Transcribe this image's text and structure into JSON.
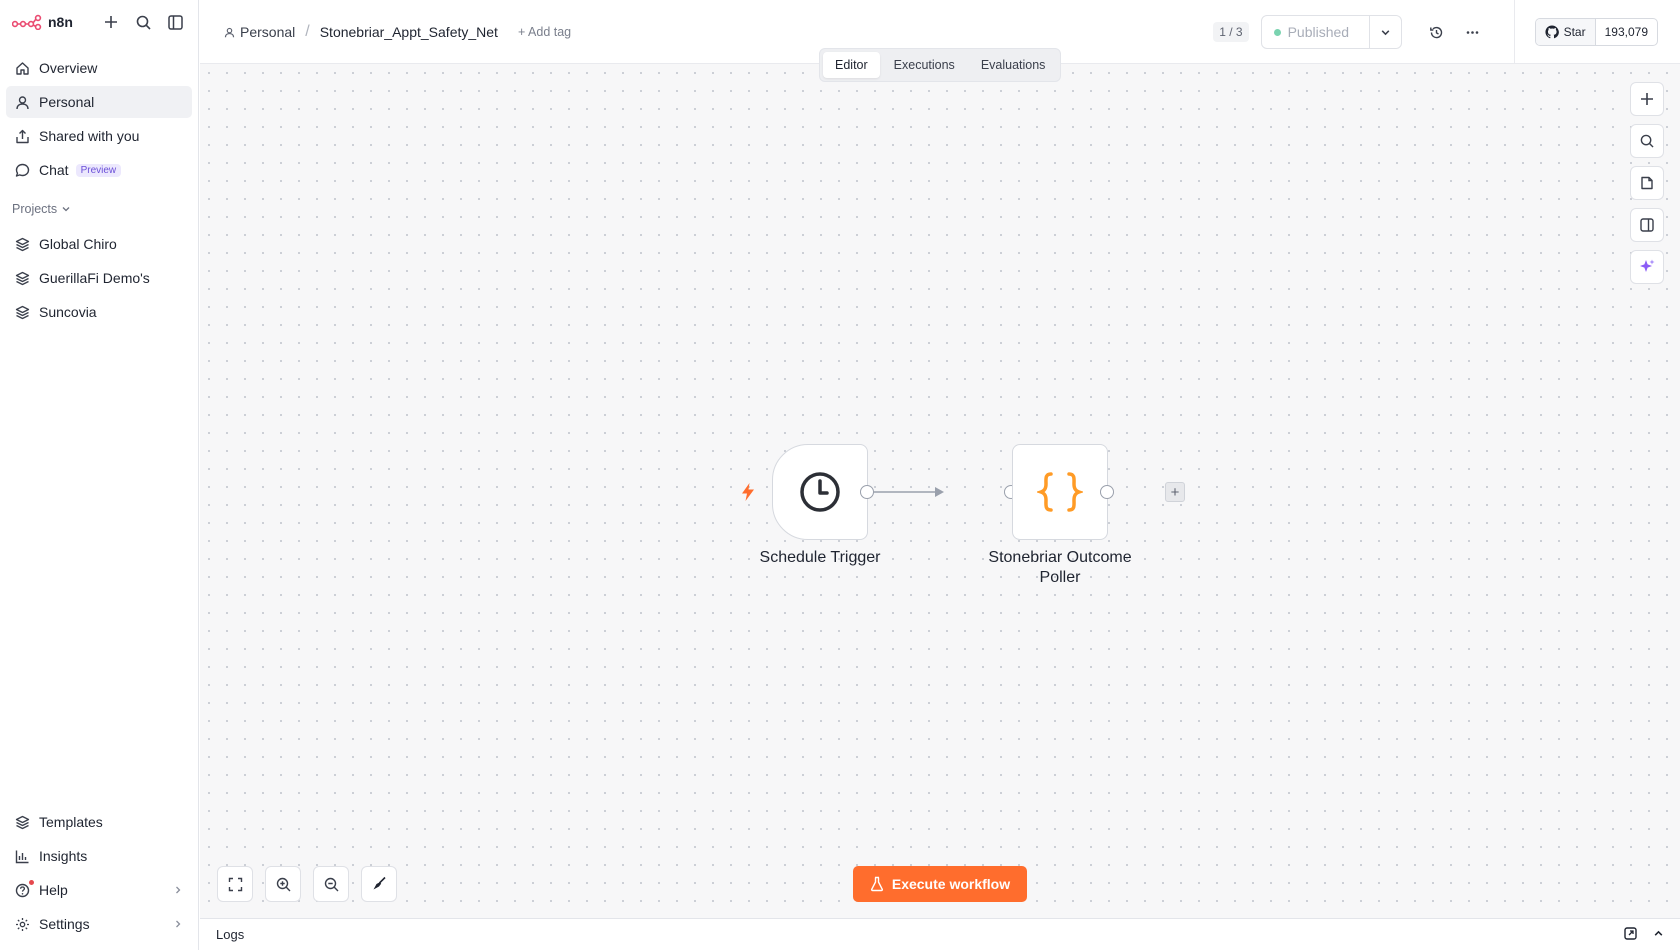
{
  "app": {
    "name": "n8n"
  },
  "sidebar": {
    "nav": [
      {
        "label": "Overview",
        "icon": "home-icon"
      },
      {
        "label": "Personal",
        "icon": "user-icon",
        "active": true
      },
      {
        "label": "Shared with you",
        "icon": "share-icon"
      },
      {
        "label": "Chat",
        "icon": "chat-icon",
        "badge": "Preview"
      }
    ],
    "projects_label": "Projects",
    "projects": [
      {
        "label": "Global Chiro",
        "icon": "layers-icon"
      },
      {
        "label": "GuerillaFi Demo's",
        "icon": "layers-icon"
      },
      {
        "label": "Suncovia",
        "icon": "layers-icon"
      }
    ],
    "bottom": [
      {
        "label": "Templates",
        "icon": "templates-icon"
      },
      {
        "label": "Insights",
        "icon": "chart-icon"
      },
      {
        "label": "Help",
        "icon": "help-icon"
      },
      {
        "label": "Settings",
        "icon": "gear-icon"
      }
    ]
  },
  "header": {
    "breadcrumb_personal": "Personal",
    "workflow_name": "Stonebriar_Appt_Safety_Net",
    "add_tag": "+ Add tag",
    "counter": "1 / 3",
    "published_label": "Published",
    "github_star": "Star",
    "github_count": "193,079"
  },
  "tabs": [
    "Editor",
    "Executions",
    "Evaluations"
  ],
  "canvas": {
    "nodes": [
      {
        "label": "Schedule Trigger",
        "icon": "clock-icon"
      },
      {
        "label": "Stonebriar Outcome Poller",
        "icon": "code-braces-icon"
      }
    ],
    "execute_label": "Execute workflow"
  },
  "logs": {
    "label": "Logs"
  },
  "colors": {
    "accent": "#ff6d2d",
    "published_dot": "#7ad3b0",
    "badge": "#6b4fd8"
  }
}
